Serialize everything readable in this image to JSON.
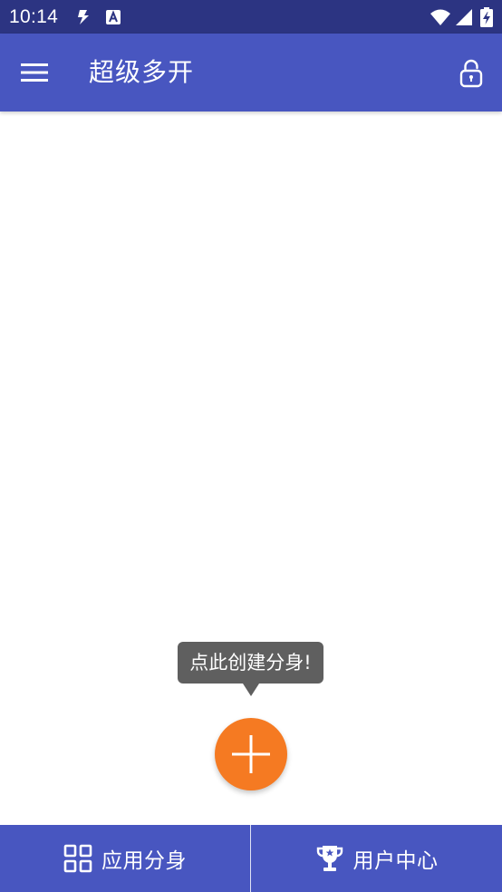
{
  "status_bar": {
    "time": "10:14",
    "icons": [
      "notification-s-icon",
      "notification-a-icon",
      "wifi-icon",
      "cellular-signal-icon",
      "battery-charging-icon"
    ]
  },
  "app_bar": {
    "title": "超级多开",
    "menu_icon": "hamburger-menu-icon",
    "lock_icon": "unlock-icon"
  },
  "tooltip": {
    "text": "点此创建分身!"
  },
  "fab": {
    "icon": "plus-icon"
  },
  "bottom_nav": {
    "tabs": [
      {
        "label": "应用分身",
        "icon": "grid-apps-icon"
      },
      {
        "label": "用户中心",
        "icon": "trophy-icon"
      }
    ]
  },
  "colors": {
    "status_bar": "#2c3482",
    "app_bar": "#4856c0",
    "accent": "#f57a22",
    "tooltip_bg": "#5f5f5f",
    "background": "#ffffff"
  }
}
